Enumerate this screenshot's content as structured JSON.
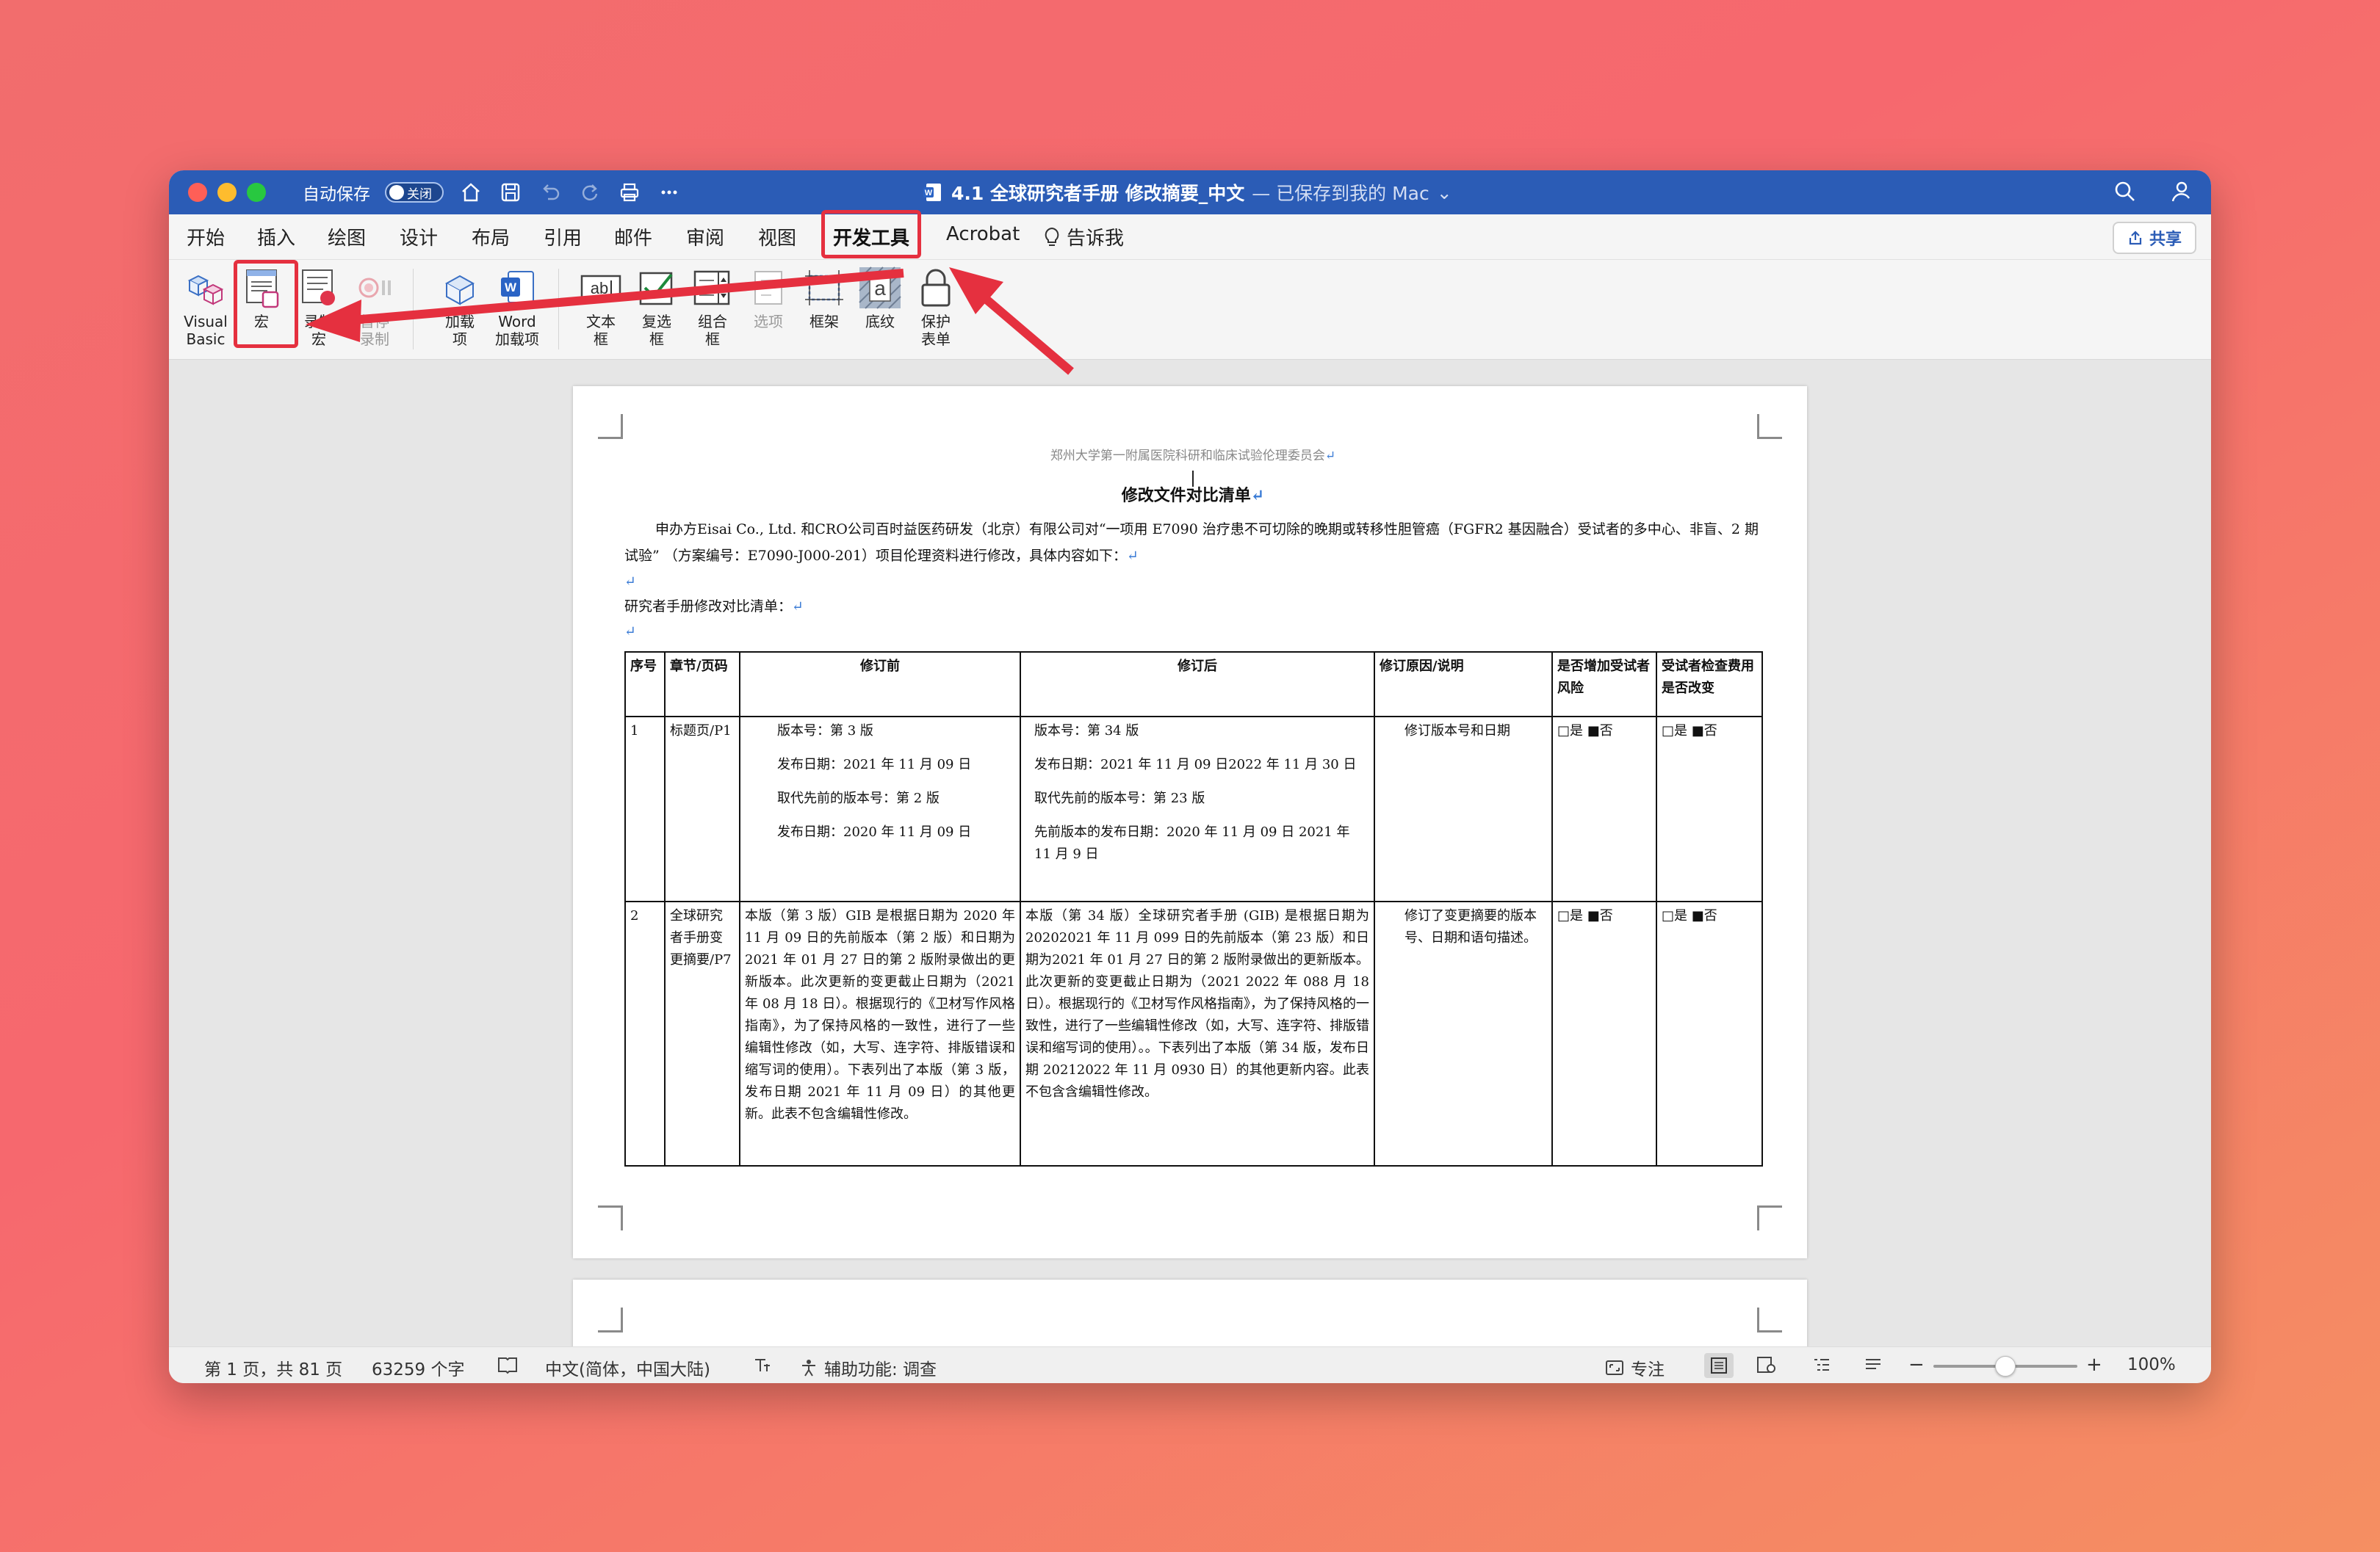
{
  "window": {
    "autosave_label": "自动保存",
    "autosave_state": "关闭",
    "title": "4.1 全球研究者手册 修改摘要_中文",
    "title_suffix": "— 已保存到我的 Mac",
    "colors": {
      "titlebar": "#2b5cb6",
      "highlight": "#e5303f"
    }
  },
  "tabs": [
    "开始",
    "插入",
    "绘图",
    "设计",
    "布局",
    "引用",
    "邮件",
    "审阅",
    "视图",
    "开发工具",
    "Acrobat",
    "告诉我"
  ],
  "active_tab": "开发工具",
  "share_label": "共享",
  "ribbon": {
    "visual_basic": [
      "Visual",
      "Basic"
    ],
    "macros": "宏",
    "record_macro": [
      "录制",
      "宏"
    ],
    "pause_recording": [
      "暂停",
      "录制"
    ],
    "addins": [
      "加载",
      "项"
    ],
    "word_addins": [
      "Word",
      "加载项"
    ],
    "textbox": [
      "文本",
      "框"
    ],
    "checkbox": [
      "复选",
      "框"
    ],
    "combobox": [
      "组合",
      "框"
    ],
    "options": "选项",
    "frame": "框架",
    "shading": "底纹",
    "protect_form": [
      "保护",
      "表单"
    ]
  },
  "document": {
    "header": "郑州大学第一附属医院科研和临床试验伦理委员会",
    "title": "修改文件对比清单",
    "intro": "申办方Eisai Co., Ltd. 和CRO公司百时益医药研发（北京）有限公司对“一项用 E7090 治疗患不可切除的晚期或转移性胆管癌（FGFR2 基因融合）受试者的多中心、非盲、2 期试验” （方案编号：E7090-J000-201）项目伦理资料进行修改，具体内容如下：",
    "list_label": "研究者手册修改对比清单：",
    "table": {
      "headers": [
        "序号",
        "章节/页码",
        "修订前",
        "修订后",
        "修订原因/说明",
        "是否增加受试者风险",
        "受试者检查费用是否改变"
      ],
      "rows": [
        {
          "no": "1",
          "section": "标题页/P1",
          "before": [
            "版本号：第 3 版",
            "发布日期：2021 年 11 月 09 日",
            "取代先前的版本号：第 2 版",
            "发布日期：2020 年 11 月 09 日"
          ],
          "after": [
            "版本号：第 34 版",
            "发布日期：2021 年 11 月 09 日2022 年 11 月 30 日",
            "取代先前的版本号：第 23 版",
            "先前版本的发布日期：2020 年 11 月 09 日 2021 年 11 月 9 日"
          ],
          "reason": "修订版本号和日期",
          "risk": "□是 ■否",
          "fee": "□是 ■否"
        },
        {
          "no": "2",
          "section": "全球研究者手册变更摘要/P7",
          "before": "本版（第 3 版）GIB 是根据日期为 2020 年 11 月 09 日的先前版本（第 2 版）和日期为2021 年 01 月 27 日的第 2 版附录做出的更新版本。此次更新的变更截止日期为（2021 年 08 月 18 日）。根据现行的《卫材写作风格指南》，为了保持风格的一致性，进行了一些编辑性修改（如，大写、连字符、排版错误和缩写词的使用）。下表列出了本版（第 3 版，发布日期 2021 年 11 月 09 日）的其他更新。此表不包含编辑性修改。",
          "after": "本版（第 34 版）全球研究者手册 (GIB) 是根据日期为 20202021 年 11 月 099 日的先前版本（第 23 版）和日期为2021 年 01 月 27 日的第 2 版附录做出的更新版本。此次更新的变更截止日期为（2021 2022 年 088 月 18 日）。根据现行的《卫材写作风格指南》，为了保持风格的一致性，进行了一些编辑性修改（如，大写、连字符、排版错误和缩写词的使用）。。下表列出了本版（第 34 版，发布日期 20212022 年 11 月 0930 日）的其他更新内容。此表不包含含编辑性修改。",
          "reason": "修订了变更摘要的版本号、日期和语句描述。",
          "risk": "□是 ■否",
          "fee": "□是 ■否"
        }
      ]
    }
  },
  "status": {
    "page": "第 1 页，共 81 页",
    "words": "63259 个字",
    "language": "中文(简体，中国大陆)",
    "accessibility": "辅助功能: 调查",
    "focus": "专注",
    "zoom": "100%"
  }
}
